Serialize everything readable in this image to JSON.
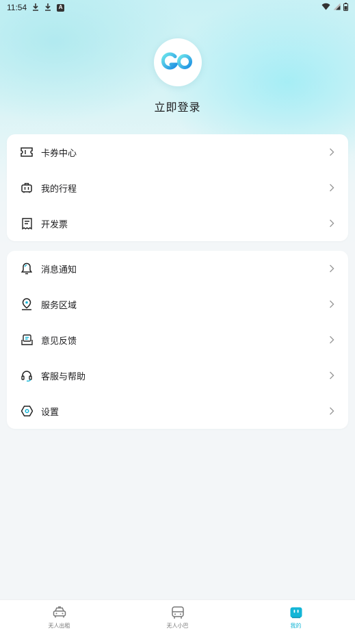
{
  "status_bar": {
    "time": "11:54",
    "a_badge": "A"
  },
  "profile": {
    "login_label": "立即登录",
    "avatar_icon": "go-logo-icon"
  },
  "menu_group_1": [
    {
      "label": "卡券中心",
      "icon": "ticket-icon"
    },
    {
      "label": "我的行程",
      "icon": "luggage-icon"
    },
    {
      "label": "开发票",
      "icon": "receipt-icon"
    }
  ],
  "menu_group_2": [
    {
      "label": "消息通知",
      "icon": "bell-icon"
    },
    {
      "label": "服务区域",
      "icon": "location-pin-icon"
    },
    {
      "label": "意见反馈",
      "icon": "feedback-icon"
    },
    {
      "label": "客服与帮助",
      "icon": "headset-icon"
    },
    {
      "label": "设置",
      "icon": "settings-icon"
    }
  ],
  "tabbar": [
    {
      "label": "无人出租",
      "icon": "taxi-icon",
      "active": false
    },
    {
      "label": "无人小巴",
      "icon": "minibus-icon",
      "active": false
    },
    {
      "label": "我的",
      "icon": "profile-robot-icon",
      "active": true
    }
  ],
  "colors": {
    "accent": "#13b5d6",
    "logo_light": "#5fe0e8",
    "logo_dark": "#1a8fe0"
  }
}
